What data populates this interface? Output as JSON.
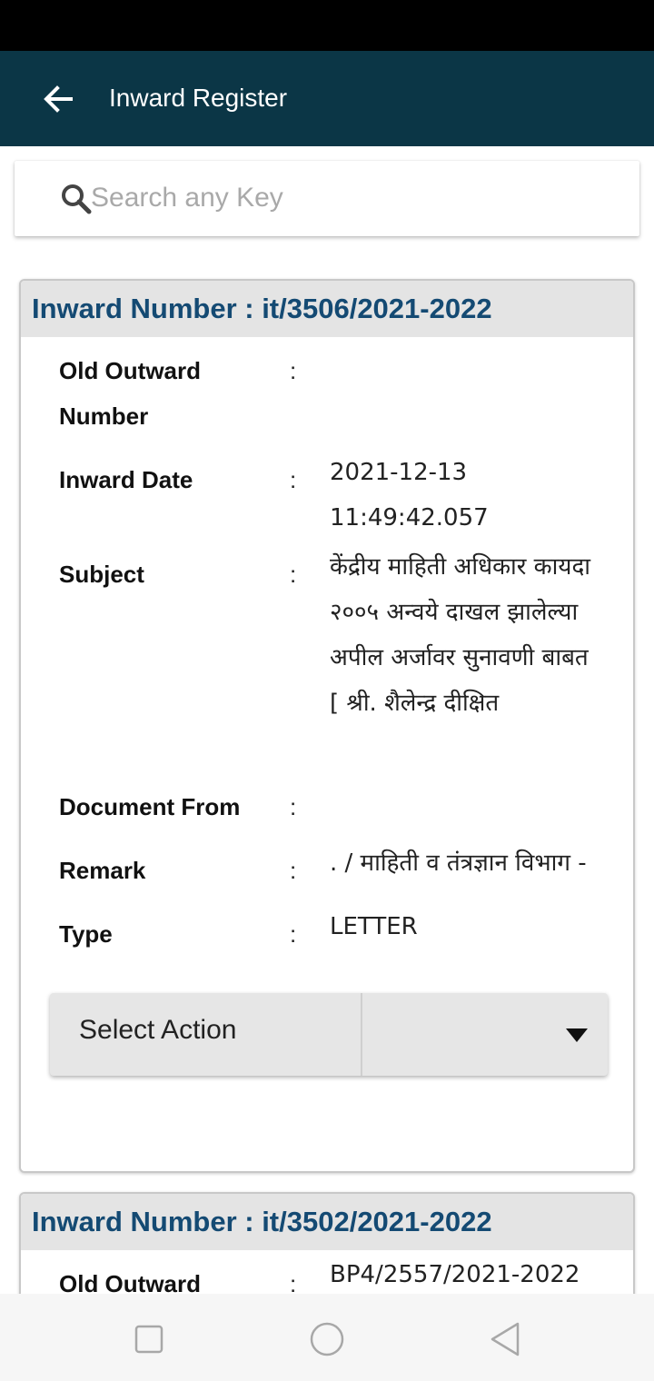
{
  "app_bar": {
    "title": "Inward Register",
    "back_icon": "arrow-left-icon"
  },
  "search": {
    "placeholder": "Search any Key",
    "value": ""
  },
  "colors": {
    "app_bar_bg": "#0b3646",
    "card_header_text": "#144a73",
    "card_header_bg": "#e4e4e4"
  },
  "records": [
    {
      "header": "Inward Number : it/3506/2021-2022",
      "fields": [
        {
          "label": "Old Outward Number",
          "colon": ":",
          "value": ""
        },
        {
          "label": "Inward Date",
          "colon": ":",
          "value": "2021-12-13 11:49:42.057"
        },
        {
          "label": "Subject",
          "colon": ":",
          "value": "केंद्रीय माहिती अधिकार कायदा २००५ अन्वये दाखल झालेल्या अपील अर्जावर सुनावणी बाबत [ श्री. शैलेन्द्र दीक्षित"
        },
        {
          "label": "Document From",
          "colon": ":",
          "value": ""
        },
        {
          "label": "Remark",
          "colon": ":",
          "value": ". / माहिती व तंत्रज्ञान विभाग -"
        },
        {
          "label": "Type",
          "colon": ":",
          "value": "LETTER"
        }
      ],
      "action_select": {
        "label": "Select Action",
        "icon": "dropdown-caret-icon"
      }
    },
    {
      "header": "Inward Number : it/3502/2021-2022",
      "fields": [
        {
          "label": "Old Outward",
          "colon": ":",
          "value": "BP4/2557/2021-2022"
        }
      ]
    }
  ],
  "nav_bar": {
    "icons": [
      "recent-apps-icon",
      "home-icon",
      "back-triangle-icon"
    ]
  }
}
